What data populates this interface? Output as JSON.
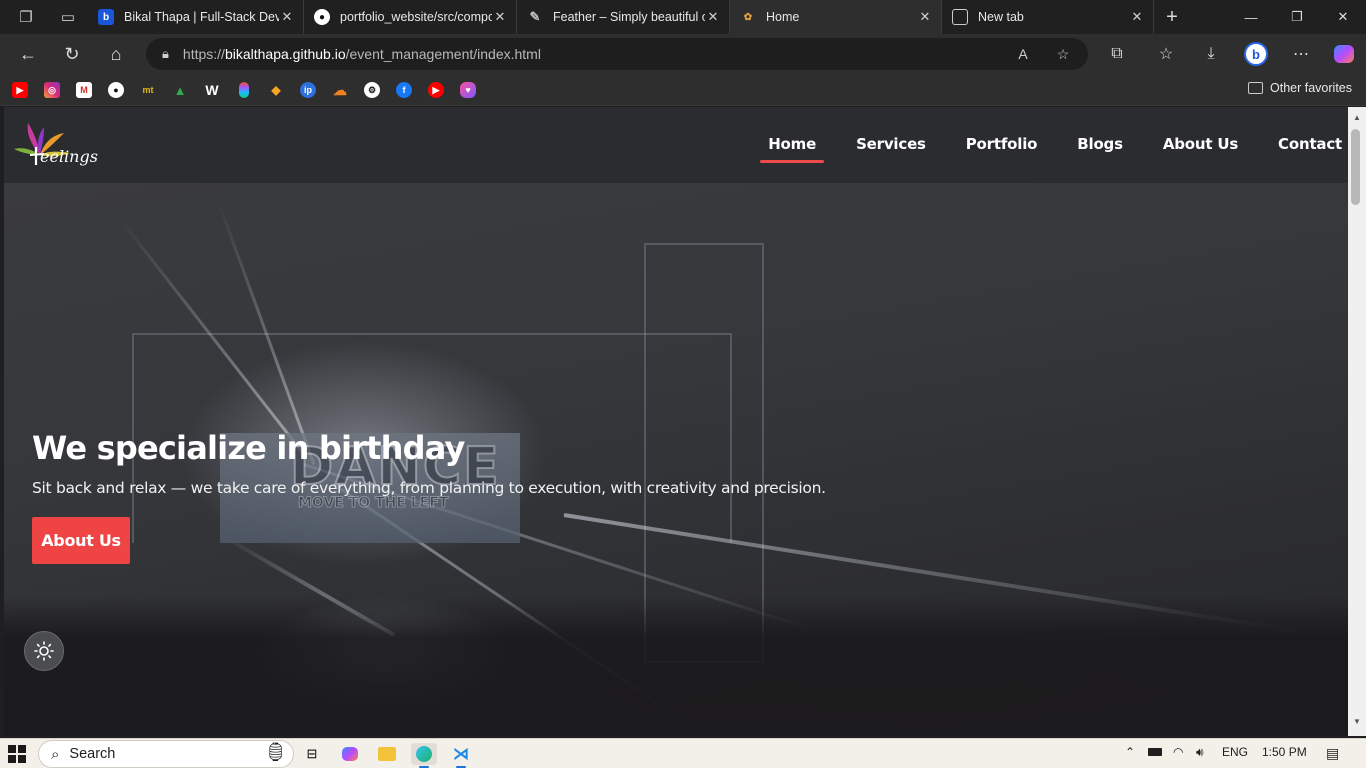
{
  "browser": {
    "tabs": [
      {
        "title": "Bikal Thapa | Full-Stack Deve",
        "favicon": "b-icon",
        "active": false
      },
      {
        "title": "portfolio_website/src/compo",
        "favicon": "github-icon",
        "active": false
      },
      {
        "title": "Feather – Simply beautiful op",
        "favicon": "feather-icon",
        "active": false
      },
      {
        "title": "Home",
        "favicon": "feelings-icon",
        "active": true
      },
      {
        "title": "New tab",
        "favicon": "newtab-icon",
        "active": false
      }
    ],
    "address": {
      "scheme": "https://",
      "host": "bikalthapa.github.io",
      "path": "/event_management/index.html"
    },
    "favorites_bar": {
      "items": [
        "youtube-icon",
        "instagram-icon",
        "gmail-icon",
        "github-icon",
        "monkeytype-icon",
        "google-drive-icon",
        "wordpress-icon",
        "figma-icon",
        "codeforces-icon",
        "app-icon",
        "cloudflare-icon",
        "openai-icon",
        "facebook-icon",
        "youtube-music-icon",
        "app-icon"
      ],
      "other_label": "Other favorites"
    }
  },
  "site": {
    "logo_text": "eelings",
    "nav": [
      {
        "label": "Home",
        "active": true
      },
      {
        "label": "Services",
        "active": false
      },
      {
        "label": "Portfolio",
        "active": false
      },
      {
        "label": "Blogs",
        "active": false
      },
      {
        "label": "About Us",
        "active": false
      },
      {
        "label": "Contact",
        "active": false
      }
    ],
    "hero": {
      "title": "We specialize in birthday",
      "subtitle": "Sit back and relax — we take care of everything, from planning to execution, with creativity and precision.",
      "button": "About Us",
      "screen_big": "DANCE",
      "screen_small": "MOVE TO THE LEFT"
    },
    "accent_color": "#ef4444"
  },
  "taskbar": {
    "search_placeholder": "Search",
    "language": "ENG",
    "time": "1:50 PM"
  }
}
